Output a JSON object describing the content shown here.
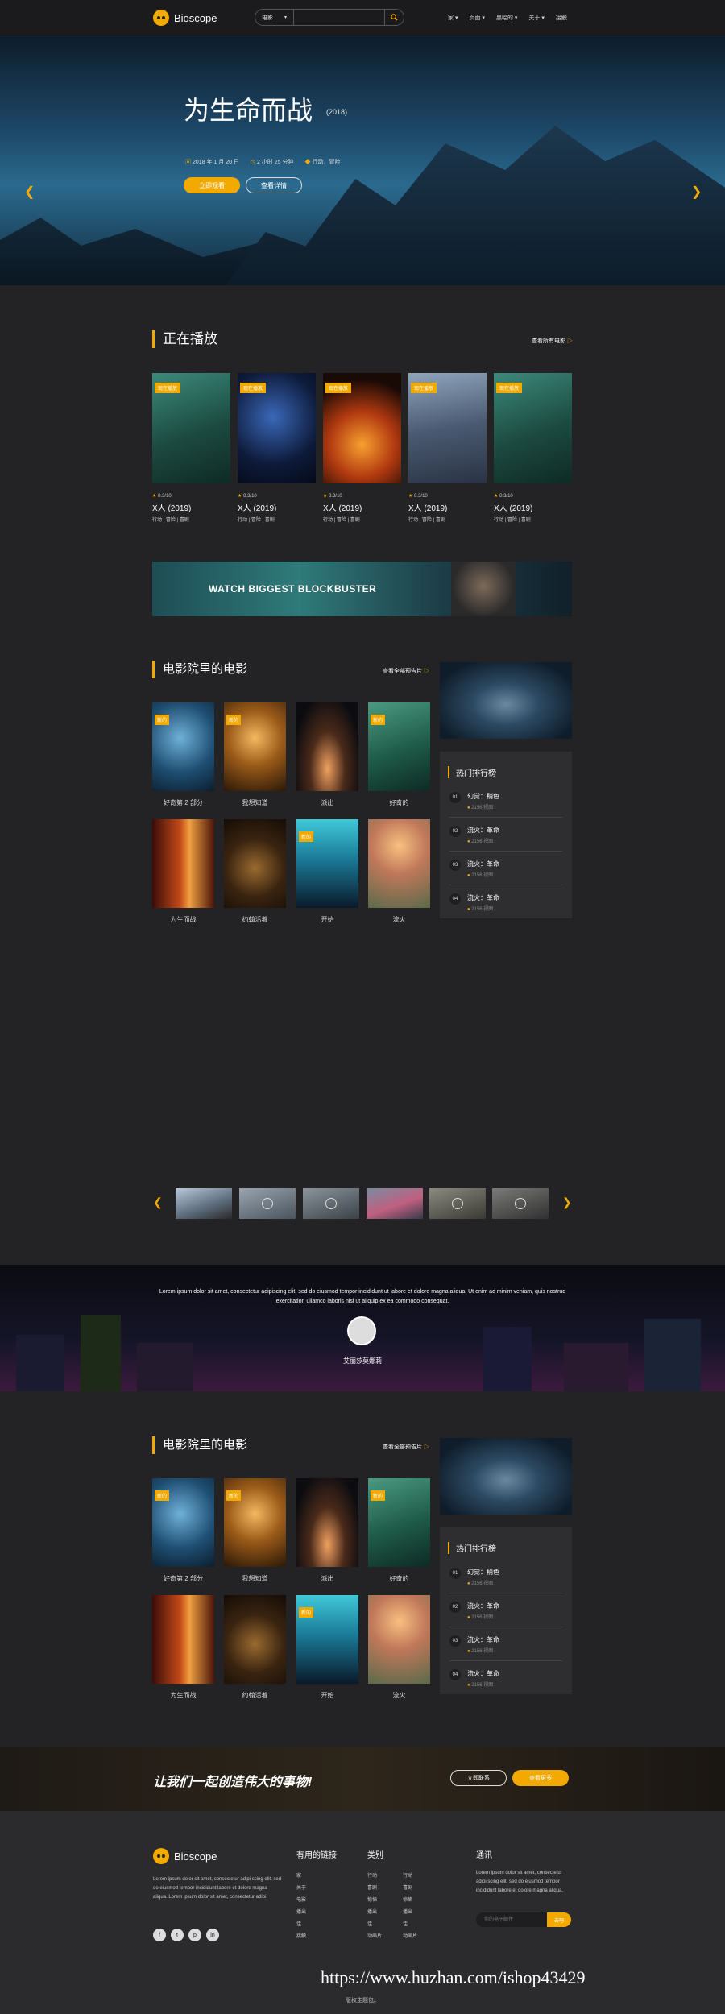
{
  "header": {
    "logo": "Bioscope",
    "search_category": "电影",
    "search_placeholder": "",
    "nav": [
      "家",
      "页面",
      "黑幅的",
      "关于",
      "接触"
    ]
  },
  "hero": {
    "title": "为生命而战",
    "year": "(2018)",
    "date": "2018 年 1 月 20 日",
    "duration": "2 小时 25 分钟",
    "genres": "行动，冒险",
    "btn_primary": "立即观看",
    "btn_secondary": "查看详情"
  },
  "now_playing": {
    "title": "正在播放",
    "see_all": "查看所有电影",
    "items": [
      {
        "badge": "现在播放",
        "rating": "8.3/10",
        "title": "X人 (2019)",
        "tags": "行动   |   冒险   |   喜剧"
      },
      {
        "badge": "现在播放",
        "rating": "8.3/10",
        "title": "X人 (2019)",
        "tags": "行动   |   冒险   |   喜剧"
      },
      {
        "badge": "现在播放",
        "rating": "8.3/10",
        "title": "X人 (2019)",
        "tags": "行动   |   冒险   |   喜剧"
      },
      {
        "badge": "现在播放",
        "rating": "8.3/10",
        "title": "X人 (2019)",
        "tags": "行动   |   冒险   |   喜剧"
      },
      {
        "badge": "现在播放",
        "rating": "8.3/10",
        "title": "X人 (2019)",
        "tags": "行动   |   冒险   |   喜剧"
      }
    ]
  },
  "banner": {
    "text": "WATCH BIGGEST BLOCKBUSTER"
  },
  "cinema1": {
    "title": "电影院里的电影",
    "see_all": "查看全部预告片",
    "items": [
      {
        "label": "好奇第 2 部分",
        "badge": "新的"
      },
      {
        "label": "我想知道",
        "badge": "新的"
      },
      {
        "label": "派出",
        "badge": ""
      },
      {
        "label": "好奇的",
        "badge": "新的"
      },
      {
        "label": "为生而战",
        "badge": ""
      },
      {
        "label": "约翰活着",
        "badge": ""
      },
      {
        "label": "开始",
        "badge": "新的"
      },
      {
        "label": "流火",
        "badge": ""
      }
    ]
  },
  "ranking1": {
    "title": "热门排行榜",
    "items": [
      {
        "num": "01",
        "name": "幻觉：稍色",
        "views": "2156 视图"
      },
      {
        "num": "02",
        "name": "流火：革命",
        "views": "2156 视图"
      },
      {
        "num": "03",
        "name": "流火：革命",
        "views": "2156 视图"
      },
      {
        "num": "04",
        "name": "流火：革命",
        "views": "2156 视图"
      }
    ]
  },
  "testimonial": {
    "text": "Lorem ipsum dolor sit amet, consectetur adipiscing elit, sed do eiusmod tempor incididunt ut labore et dolore magna aliqua. Ut enim ad minim veniam, quis nostrud exercitation ullamco laboris nisi ut aliquip ex ea commodo consequat.",
    "name": "艾丽莎莫娜莉"
  },
  "cinema2": {
    "title": "电影院里的电影",
    "see_all": "查看全部预告片",
    "items": [
      {
        "label": "好奇第 2 部分",
        "badge": "新的"
      },
      {
        "label": "我想知道",
        "badge": "新的"
      },
      {
        "label": "派出",
        "badge": ""
      },
      {
        "label": "好奇的",
        "badge": "新的"
      },
      {
        "label": "为生而战",
        "badge": ""
      },
      {
        "label": "约翰活着",
        "badge": ""
      },
      {
        "label": "开始",
        "badge": "新的"
      },
      {
        "label": "流火",
        "badge": ""
      }
    ]
  },
  "ranking2": {
    "title": "热门排行榜",
    "items": [
      {
        "num": "01",
        "name": "幻觉：稍色",
        "views": "2156 视图"
      },
      {
        "num": "02",
        "name": "流火：革命",
        "views": "2156 视图"
      },
      {
        "num": "03",
        "name": "流火：革命",
        "views": "2156 视图"
      },
      {
        "num": "04",
        "name": "流火：革命",
        "views": "2156 视图"
      }
    ]
  },
  "cta": {
    "text": "让我们一起创造伟大的事物!",
    "btn1": "立即联系",
    "btn2": "查看更多"
  },
  "footer": {
    "logo": "Bioscope",
    "about": "Lorem ipsum dolor sit amet, consectetur adipi scing elit, sed do eiusmod tempor incididunt labore et dolore magna aliqua. Lorem ipsum dolor sit amet, consectetur adipi",
    "links_title": "有用的链接",
    "links": [
      "家",
      "关于",
      "电影",
      "播出",
      "佳",
      "接触"
    ],
    "cat_title": "类别",
    "cat1": [
      "行动",
      "喜剧",
      "惊悚",
      "播出",
      "佳",
      "动画片"
    ],
    "cat2": [
      "行动",
      "喜剧",
      "惊悚",
      "播出",
      "佳",
      "动画片"
    ],
    "news_title": "通讯",
    "news_text": "Lorem ipsum dolor sit amet, consectetur adipi scing elit, sed do eiusmod tempor incididunt labore et dolore magna aliqua.",
    "news_placeholder": "你的电子邮件",
    "news_btn": "去吧",
    "social": [
      "f",
      "t",
      "p",
      "in"
    ],
    "copyright": "版权主题包。"
  },
  "watermark": "https://www.huzhan.com/ishop43429",
  "colors": {
    "accent": "#f2a900",
    "background": "#232325"
  }
}
